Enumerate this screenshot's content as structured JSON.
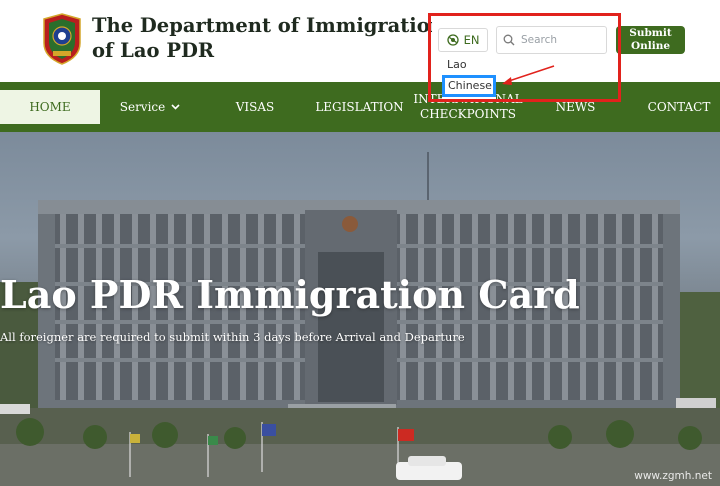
{
  "header": {
    "title_line1": "The Department of Immigration",
    "title_line2": "of Lao PDR"
  },
  "language": {
    "current": "EN",
    "options": [
      "Lao",
      "Chinese"
    ],
    "highlighted": "Chinese"
  },
  "search": {
    "placeholder": "Search"
  },
  "submit": {
    "line1": "Submit",
    "line2": "Online"
  },
  "nav": {
    "items": [
      {
        "label": "HOME",
        "active": true
      },
      {
        "label": "Service",
        "has_dropdown": true
      },
      {
        "label": "VISAS"
      },
      {
        "label": "LEGISLATION"
      },
      {
        "label_line1": "INTERNATIONAL",
        "label_line2": "CHECKPOINTS"
      },
      {
        "label": "NEWS"
      },
      {
        "label": "CONTACT"
      }
    ]
  },
  "hero": {
    "title": "Lao PDR Immigration Card",
    "subtitle": "All foreigner are required to submit within 3 days before Arrival and Departure"
  },
  "watermark": "www.zgmh.net",
  "icons": {
    "logo": "lao-emblem-logo",
    "language": "globe-icon",
    "search": "search-icon",
    "service": "chevron-down-icon"
  },
  "colors": {
    "brand_green": "#3e6b1f",
    "active_nav_bg": "#eef5e4",
    "annotation_red": "#e1221c",
    "highlight_blue": "#1e90ff"
  }
}
